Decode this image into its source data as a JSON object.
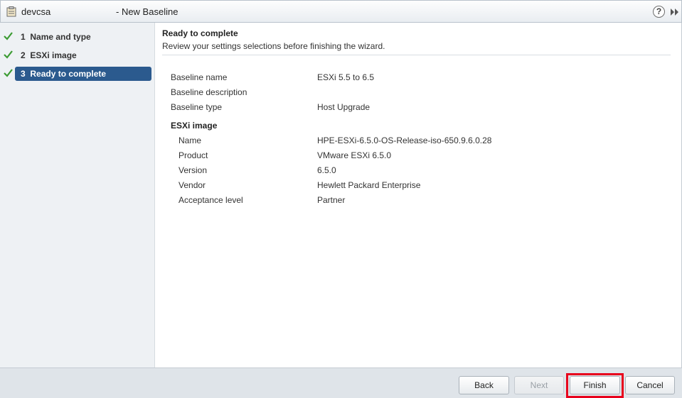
{
  "window": {
    "host": "devcsa",
    "title": "- New Baseline",
    "help_glyph": "?"
  },
  "steps": [
    {
      "number": "1",
      "label": "Name and type",
      "completed": true,
      "active": false
    },
    {
      "number": "2",
      "label": "ESXi image",
      "completed": true,
      "active": false
    },
    {
      "number": "3",
      "label": "Ready to complete",
      "completed": true,
      "active": true
    }
  ],
  "page": {
    "heading": "Ready to complete",
    "subheading": "Review your settings selections before finishing the wizard."
  },
  "summary": {
    "baseline_name_label": "Baseline name",
    "baseline_name_value": "ESXi 5.5 to 6.5",
    "baseline_description_label": "Baseline description",
    "baseline_description_value": "",
    "baseline_type_label": "Baseline type",
    "baseline_type_value": "Host Upgrade",
    "esxi_section": "ESXi image",
    "name_label": "Name",
    "name_value": "HPE-ESXi-6.5.0-OS-Release-iso-650.9.6.0.28",
    "product_label": "Product",
    "product_value": "VMware ESXi 6.5.0",
    "version_label": "Version",
    "version_value": "6.5.0",
    "vendor_label": "Vendor",
    "vendor_value": "Hewlett Packard Enterprise",
    "acceptance_label": "Acceptance level",
    "acceptance_value": "Partner"
  },
  "buttons": {
    "back": "Back",
    "next": "Next",
    "finish": "Finish",
    "cancel": "Cancel"
  },
  "colors": {
    "active_step": "#2b5a8e",
    "check": "#3c9b33",
    "highlight": "#e8001c"
  },
  "icons": {
    "app": "baseline-icon",
    "help": "help-icon",
    "expand": "expand-icon",
    "check": "check-icon"
  }
}
